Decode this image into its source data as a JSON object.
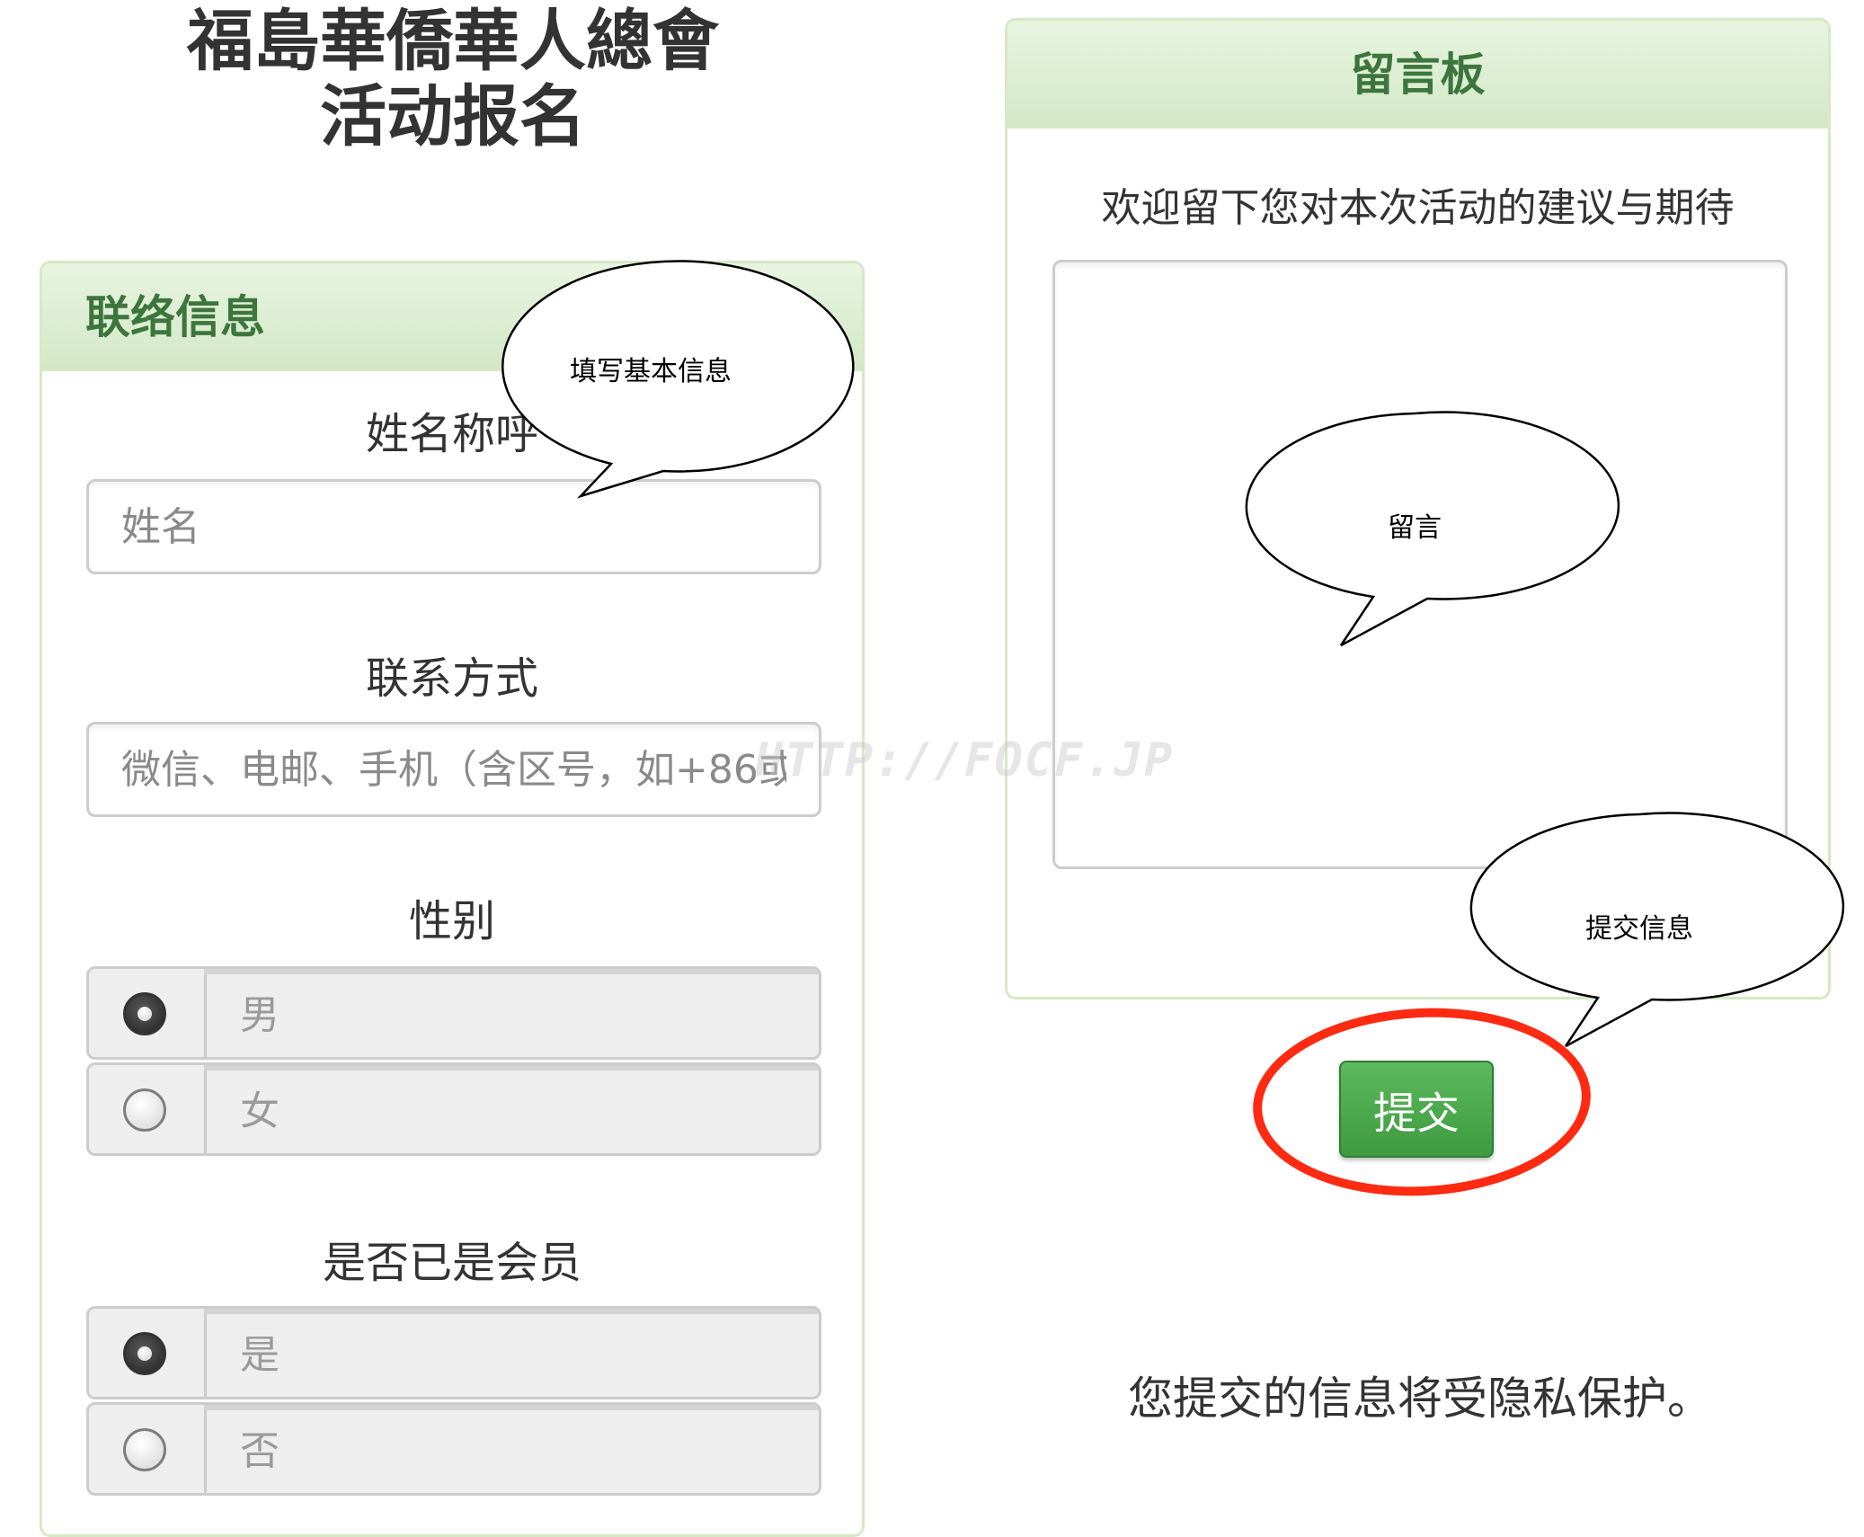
{
  "title": {
    "line1": "福島華僑華人總會",
    "line2": "活动报名"
  },
  "contact": {
    "header": "联络信息",
    "name_label": "姓名称呼",
    "name_placeholder": "姓名",
    "contact_label": "联系方式",
    "contact_placeholder": "微信、电邮、手机（含区号，如+86或",
    "gender": {
      "label": "性别",
      "options": [
        {
          "label": "男",
          "checked": true
        },
        {
          "label": "女",
          "checked": false
        }
      ]
    },
    "member": {
      "label": "是否已是会员",
      "options": [
        {
          "label": "是",
          "checked": true
        },
        {
          "label": "否",
          "checked": false
        }
      ]
    }
  },
  "board": {
    "header": "留言板",
    "hint": "欢迎留下您对本次活动的建议与期待"
  },
  "submit_label": "提交",
  "privacy_note": "您提交的信息将受隐私保护。",
  "watermark": "HTTP://FOCF.JP",
  "callouts": {
    "basic_info": "填写基本信息",
    "message": "留言",
    "submit_info": "提交信息"
  },
  "colors": {
    "panel_header_text": "#3c763d",
    "panel_border": "#d6e9c6",
    "submit_button": "#4cae4c",
    "highlight_ring": "#ff2a12"
  }
}
